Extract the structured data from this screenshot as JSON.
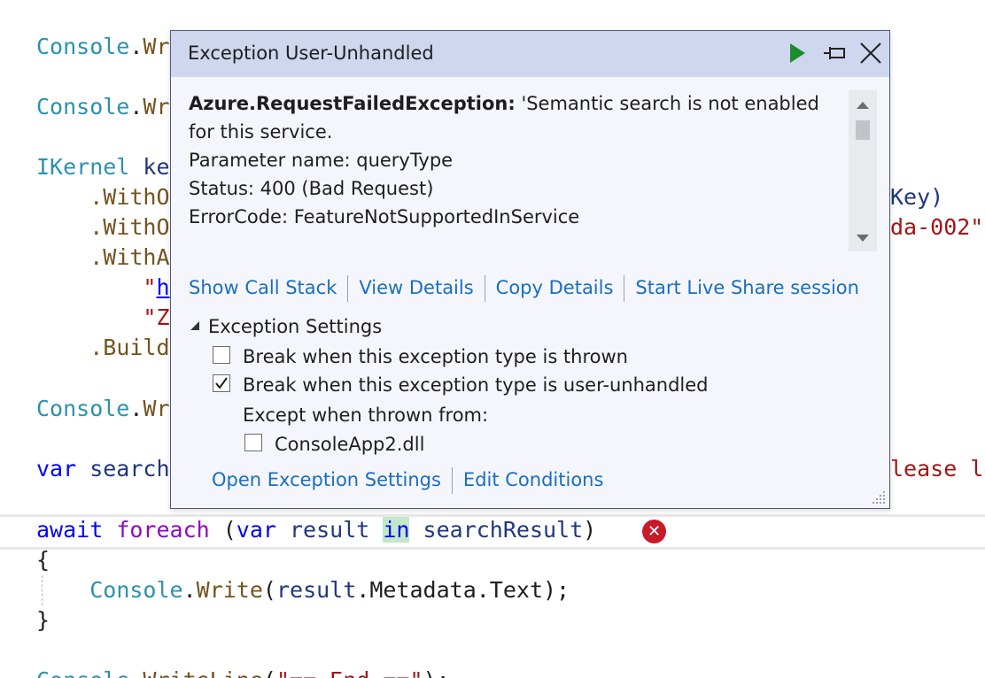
{
  "code": {
    "line1": {
      "type": "Console",
      "dot": ".",
      "method": "Wr"
    },
    "line2": {
      "type": "Console",
      "dot": ".",
      "method": "Wr"
    },
    "line3": {
      "type": "IKernel",
      "var": " ke"
    },
    "line4": {
      "indent": "    ",
      "method": ".WithO",
      "tail": "Key)"
    },
    "line5": {
      "indent": "    ",
      "method": ".WithO",
      "tail": "da-002\""
    },
    "line6": {
      "indent": "    ",
      "method": ".WithA"
    },
    "line7": {
      "indent": "        ",
      "quote": "\"",
      "link": "h"
    },
    "line8": {
      "indent": "        ",
      "str": "\"Z"
    },
    "line9": {
      "indent": "    ",
      "method": ".Build"
    },
    "line10": {
      "type": "Console",
      "dot": ".",
      "method": "Wr"
    },
    "line11": {
      "kw": "var",
      "id": " search",
      "tail": "lease le"
    },
    "line12": {
      "kw1": "await",
      "kw2": "foreach",
      "p1": " (",
      "kw3": "var",
      "id1": " result ",
      "in": "in",
      "id2": " searchResult",
      "p2": ")"
    },
    "line13": {
      "text": "{"
    },
    "line14": {
      "indent": "    ",
      "type": "Console",
      "dot": ".",
      "method": "Write",
      "p1": "(",
      "id": "result",
      "rest": ".Metadata.Text);"
    },
    "line15": {
      "text": "}"
    },
    "line16": {
      "type": "Console",
      "dot": ".",
      "method": "WriteLine",
      "p1": "(",
      "str": "\"== End ==\"",
      "p2": ");"
    }
  },
  "popup": {
    "title": "Exception User-Unhandled",
    "icons": {
      "continue": "play-icon",
      "pin": "pin-icon",
      "close": "close-icon"
    },
    "exception_name": "Azure.RequestFailedException:",
    "message": " 'Semantic search is not enabled for this service.",
    "details": [
      "Parameter name: queryType",
      "Status: 400 (Bad Request)",
      "ErrorCode: FeatureNotSupportedInService"
    ],
    "links": [
      "Show Call Stack",
      "View Details",
      "Copy Details",
      "Start Live Share session"
    ],
    "settings_header": "Exception Settings",
    "checkboxes": [
      {
        "label": "Break when this exception type is thrown",
        "checked": false
      },
      {
        "label": "Break when this exception type is user-unhandled",
        "checked": true
      }
    ],
    "except_label": "Except when thrown from:",
    "module_checkbox": {
      "label": "ConsoleApp2.dll",
      "checked": false
    },
    "bottom_links": [
      "Open Exception Settings",
      "Edit Conditions"
    ]
  },
  "colors": {
    "accent_link": "#1a6ebf",
    "header_bg": "#cfd7ef",
    "error": "#c81a28",
    "play": "#1e8c2e"
  }
}
